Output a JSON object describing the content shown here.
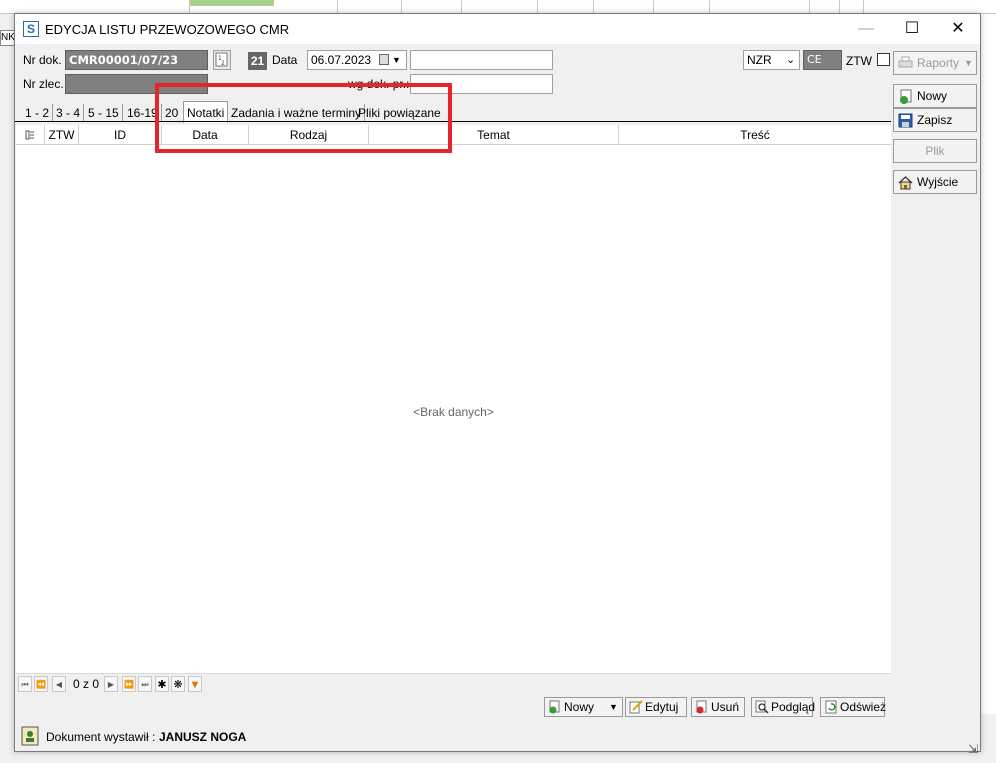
{
  "background": {
    "left_fragment": "NKA"
  },
  "window": {
    "title": "EDYCJA LISTU PRZEWOZOWEGO CMR",
    "app_icon_letter": "S",
    "minimize_glyph": "—",
    "maximize_glyph": "☐",
    "close_glyph": "✕"
  },
  "form": {
    "nr_dok_label": "Nr dok.",
    "nr_dok_value": "CMR00001/07/23",
    "nr_zlec_label": "Nr zlec.",
    "nr_zlec_value": "",
    "day_badge": "21",
    "data_label": "Data",
    "data_value": "06.07.2023",
    "extra_field_value": "",
    "wg_dok_label": "wg dok. pr.:",
    "wg_dok_value": "",
    "nzr_value": "NZR",
    "ce_value": "CE",
    "ztw_label": "ZTW"
  },
  "tabs": [
    {
      "label": "1 - 2"
    },
    {
      "label": "3 - 4"
    },
    {
      "label": "5 - 15"
    },
    {
      "label": "16-19"
    },
    {
      "label": "20"
    },
    {
      "label": "Notatki",
      "active": true
    },
    {
      "label": "Zadania i ważne terminy"
    },
    {
      "label": "Pliki powiązane"
    }
  ],
  "grid": {
    "columns": [
      "ZTW",
      "ID",
      "Data",
      "Rodzaj",
      "Temat",
      "Treść"
    ],
    "rows": [],
    "empty_message": "<Brak danych>"
  },
  "navigator": {
    "position": "0 z 0"
  },
  "bottom_buttons": {
    "nowy": "Nowy",
    "edytuj": "Edytuj",
    "usun": "Usuń",
    "podglad": "Podgląd",
    "odswiez": "Odśwież"
  },
  "side_buttons": {
    "raporty": "Raporty",
    "nowy": "Nowy",
    "zapisz": "Zapisz",
    "plik": "Plik",
    "wyjscie": "Wyjście"
  },
  "status": {
    "label": "Dokument wystawił :",
    "user": "JANUSZ NOGA"
  },
  "colors": {
    "highlight": "#e3262b",
    "grey_field": "#808080"
  }
}
